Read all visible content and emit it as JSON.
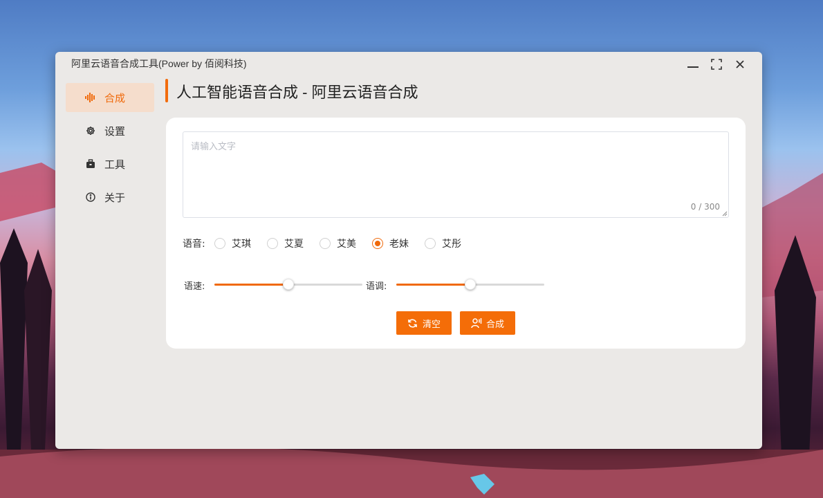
{
  "window": {
    "title": "阿里云语音合成工具(Power by 佰阅科技)"
  },
  "sidebar": {
    "items": [
      {
        "label": "合成",
        "icon": "soundwave-icon",
        "active": true
      },
      {
        "label": "设置",
        "icon": "gear-icon",
        "active": false
      },
      {
        "label": "工具",
        "icon": "toolbox-icon",
        "active": false
      },
      {
        "label": "关于",
        "icon": "info-icon",
        "active": false
      }
    ]
  },
  "main": {
    "page_title": "人工智能语音合成 - 阿里云语音合成",
    "textarea": {
      "placeholder": "请输入文字",
      "counter": "0 / 300"
    },
    "voice": {
      "label": "语音:",
      "options": [
        "艾琪",
        "艾夏",
        "艾美",
        "老妹",
        "艾彤"
      ],
      "selected": "老妹"
    },
    "sliders": {
      "speed": {
        "label": "语速:",
        "value": 0.5
      },
      "pitch": {
        "label": "语调:",
        "value": 0.5
      }
    },
    "buttons": {
      "clear": "清空",
      "synthesize": "合成"
    }
  },
  "colors": {
    "accent": "#f0690a",
    "active_bg": "#f5ddcc",
    "window_bg": "#ebe9e7"
  }
}
